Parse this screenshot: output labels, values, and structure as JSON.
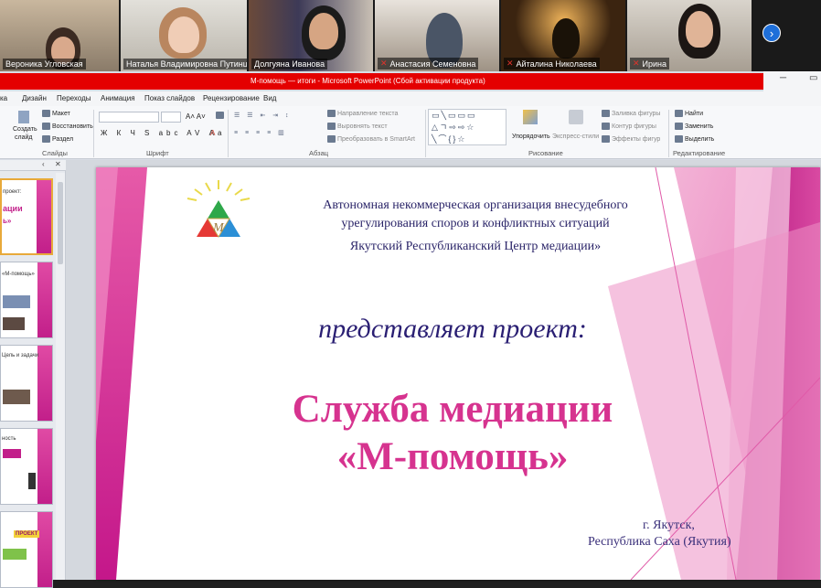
{
  "participants": [
    {
      "name": "Вероника Угловская",
      "muted": false
    },
    {
      "name": "Наталья Владимировна Путинц...",
      "muted": false
    },
    {
      "name": "Долгуяна Иванова",
      "muted": false
    },
    {
      "name": "Анастасия Семеновна",
      "muted": true
    },
    {
      "name": "Айталина Николаева",
      "muted": true
    },
    {
      "name": "Ирина",
      "muted": true
    }
  ],
  "next_icon": "chevron-right-icon",
  "window": {
    "title": "М-помощь — итоги - Microsoft PowerPoint (Сбой активации продукта)"
  },
  "menu": [
    "ка",
    "Дизайн",
    "Переходы",
    "Анимация",
    "Показ слайдов",
    "Рецензирование",
    "Вид"
  ],
  "ribbon": {
    "slides": {
      "create": "Создать",
      "create2": "слайд",
      "layout": "Макет",
      "restore": "Восстановить",
      "section": "Раздел",
      "label": "Слайды"
    },
    "font": {
      "label": "Шрифт"
    },
    "paragraph": {
      "direction": "Направление текста",
      "align": "Выровнять текст",
      "smartart": "Преобразовать в SmartArt",
      "label": "Абзац"
    },
    "drawing": {
      "arrange": "Упорядочить",
      "quick": "Экспресс-стили",
      "fill": "Заливка фигуры",
      "outline": "Контур фигуры",
      "effects": "Эффекты фигур",
      "label": "Рисование"
    },
    "editing": {
      "find": "Найти",
      "replace": "Заменить",
      "select": "Выделить",
      "label": "Редактирование"
    }
  },
  "thumbnails": [
    {
      "title": "проект:",
      "sub": "ации",
      "sub2": "ь»"
    },
    {
      "title": "«М-помощь»",
      "sub": "",
      "sub2": ""
    },
    {
      "title": "Цель и задачи",
      "sub": "",
      "sub2": ""
    },
    {
      "title": "ность",
      "sub": "",
      "sub2": ""
    },
    {
      "title": "ПРОЕКТ",
      "sub": "",
      "sub2": ""
    }
  ],
  "slide": {
    "org_line1": "Автономная некоммерческая организация внесудебного",
    "org_line2": "урегулирования споров и конфликтных ситуаций",
    "org_line3": "Якутский Республиканский  Центр медиации»",
    "presents": "представляет  проект:",
    "service_line1": "Служба медиации",
    "service_line2": "«М-помощь»",
    "city_line1": "г. Якутск,",
    "city_line2": "Республика Саха (Якутия)",
    "colors": {
      "pink": "#d6338f",
      "magenta": "#c21f8a",
      "navy": "#2a1f73"
    }
  }
}
